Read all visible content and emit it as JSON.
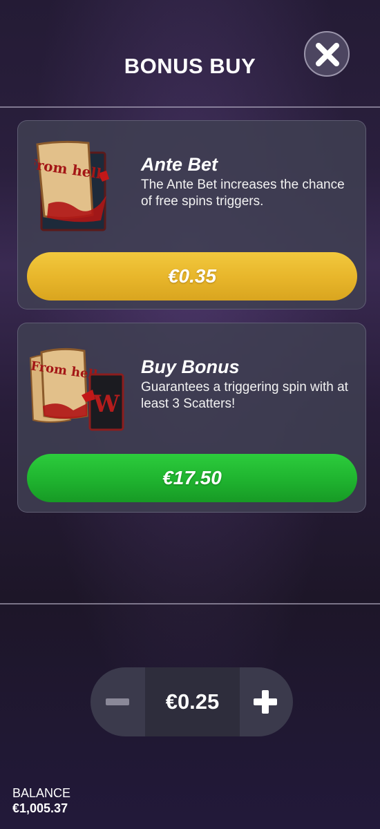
{
  "header": {
    "title": "BONUS BUY",
    "close_icon": "close-icon"
  },
  "cards": [
    {
      "title": "Ante Bet",
      "description": "The Ante Bet increases the chance of free spins triggers.",
      "price": "€0.35",
      "button_color": "#e7b52a",
      "art_text": "From hell"
    },
    {
      "title": "Buy Bonus",
      "description": "Guarantees a triggering spin with at least 3 Scatters!",
      "price": "€17.50",
      "button_color": "#1fb32f",
      "art_text": "From hell",
      "art_symbol": "W"
    }
  ],
  "bet": {
    "value": "€0.25",
    "decrease_icon": "minus-icon",
    "increase_icon": "plus-icon"
  },
  "balance": {
    "label": "BALANCE",
    "value": "€1,005.37"
  }
}
